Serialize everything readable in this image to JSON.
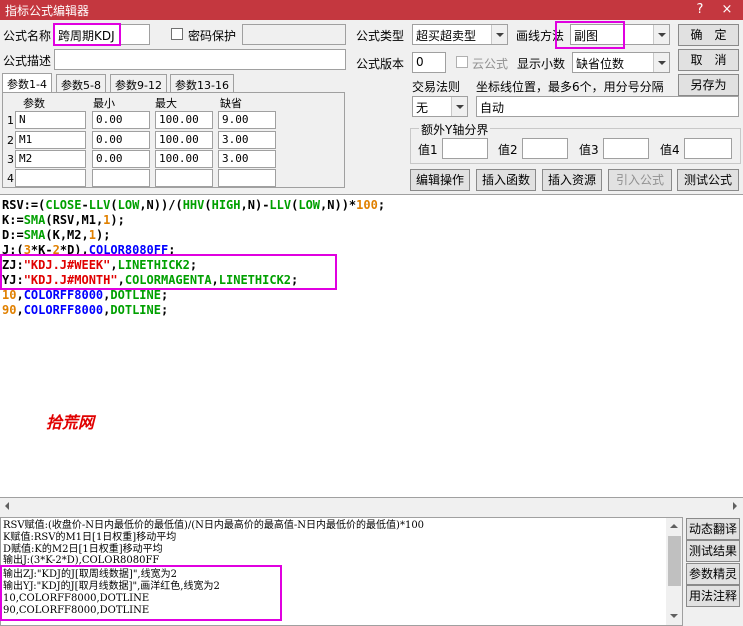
{
  "window": {
    "title": "指标公式编辑器",
    "help_glyph": "?",
    "close_glyph": "×"
  },
  "form": {
    "name_label": "公式名称",
    "name_value": "跨周期KDJ",
    "password_label": "密码保护",
    "desc_label": "公式描述",
    "type_label": "公式类型",
    "type_value": "超买超卖型",
    "draw_label": "画线方法",
    "draw_value": "副图",
    "version_label": "公式版本",
    "version_value": "0",
    "cloud_label": "云公式",
    "decimals_label": "显示小数",
    "decimals_value": "缺省位数",
    "trade_label": "交易法则",
    "trade_value": "无",
    "coord_label": "坐标线位置，最多6个，用分号分隔",
    "coord_value": "自动",
    "yaxis_label": "额外Y轴分界",
    "y1_label": "值1",
    "y2_label": "值2",
    "y3_label": "值3",
    "y4_label": "值4"
  },
  "buttons": {
    "ok": "确　定",
    "cancel": "取　消",
    "save_as": "另存为",
    "edit_ops": "编辑操作",
    "insert_func": "插入函数",
    "insert_res": "插入资源",
    "import_formula": "引入公式",
    "test_formula": "测试公式",
    "translate": "动态翻译",
    "test_result": "测试结果",
    "param_tune": "参数精灵",
    "usage_note": "用法注释"
  },
  "param_tabs": [
    "参数1-4",
    "参数5-8",
    "参数9-12",
    "参数13-16"
  ],
  "param_headers": [
    "参数",
    "最小",
    "最大",
    "缺省"
  ],
  "params": [
    {
      "row": "1",
      "name": "N",
      "min": "0.00",
      "max": "100.00",
      "default": "9.00"
    },
    {
      "row": "2",
      "name": "M1",
      "min": "0.00",
      "max": "100.00",
      "default": "3.00"
    },
    {
      "row": "3",
      "name": "M2",
      "min": "0.00",
      "max": "100.00",
      "default": "3.00"
    },
    {
      "row": "4",
      "name": "",
      "min": "",
      "max": "",
      "default": ""
    }
  ],
  "code": {
    "l1": {
      "a": "RSV:=(",
      "b": "CLOSE",
      "c": "-",
      "d": "LLV",
      "e": "(",
      "f": "LOW",
      "g": ",N))/(",
      "h": "HHV",
      "i": "(",
      "j": "HIGH",
      "k": ",N)-",
      "m": "LLV",
      "n": "(",
      "o": "LOW",
      "p": ",N))*",
      "q": "100",
      "r": ";"
    },
    "l2": {
      "a": "K:=",
      "b": "SMA",
      "c": "(RSV,M1,",
      "d": "1",
      "e": ");"
    },
    "l3": {
      "a": "D:=",
      "b": "SMA",
      "c": "(K,M2,",
      "d": "1",
      "e": ");"
    },
    "l4": {
      "a": "J:(",
      "b": "3",
      "c": "*K-",
      "d": "2",
      "e": "*D),",
      "f": "COLOR8080FF",
      "g": ";"
    },
    "l5": {
      "a": "ZJ:",
      "b": "\"KDJ.J#WEEK\"",
      "c": ",",
      "d": "LINETHICK2",
      "e": ";"
    },
    "l6": {
      "a": "YJ:",
      "b": "\"KDJ.J#MONTH\"",
      "c": ",",
      "d": "COLORMAGENTA",
      "e": ",",
      "f": "LINETHICK2",
      "g": ";"
    },
    "l7": {
      "a": "10",
      "b": ",",
      "c": "COLORFF8000",
      "d": ",",
      "e": "DOTLINE",
      "f": ";"
    },
    "l8": {
      "a": "90",
      "b": ",",
      "c": "COLORFF8000",
      "d": ",",
      "e": "DOTLINE",
      "f": ";"
    }
  },
  "watermark": "拾荒网",
  "description": [
    "RSV赋值:(收盘价-N日内最低价的最低值)/(N日内最高价的最高值-N日内最低价的最低值)*100",
    "K赋值:RSV的M1日[1日权重]移动平均",
    "D赋值:K的M2日[1日权重]移动平均",
    "输出J:(3*K-2*D),COLOR8080FF",
    "输出ZJ:\"KDJ的J[取周线数据]\",线宽为2",
    "输出YJ:\"KDJ的J[取月线数据]\",画洋红色,线宽为2",
    "10,COLORFF8000,DOTLINE",
    "90,COLORFF8000,DOTLINE"
  ],
  "colors": {
    "titlebar": "#c4373f",
    "highlight": "#e000e0",
    "keyword_green": "#00a000",
    "number_orange": "#e08000",
    "string_red": "#e00000",
    "color_blue": "#0000ff"
  }
}
